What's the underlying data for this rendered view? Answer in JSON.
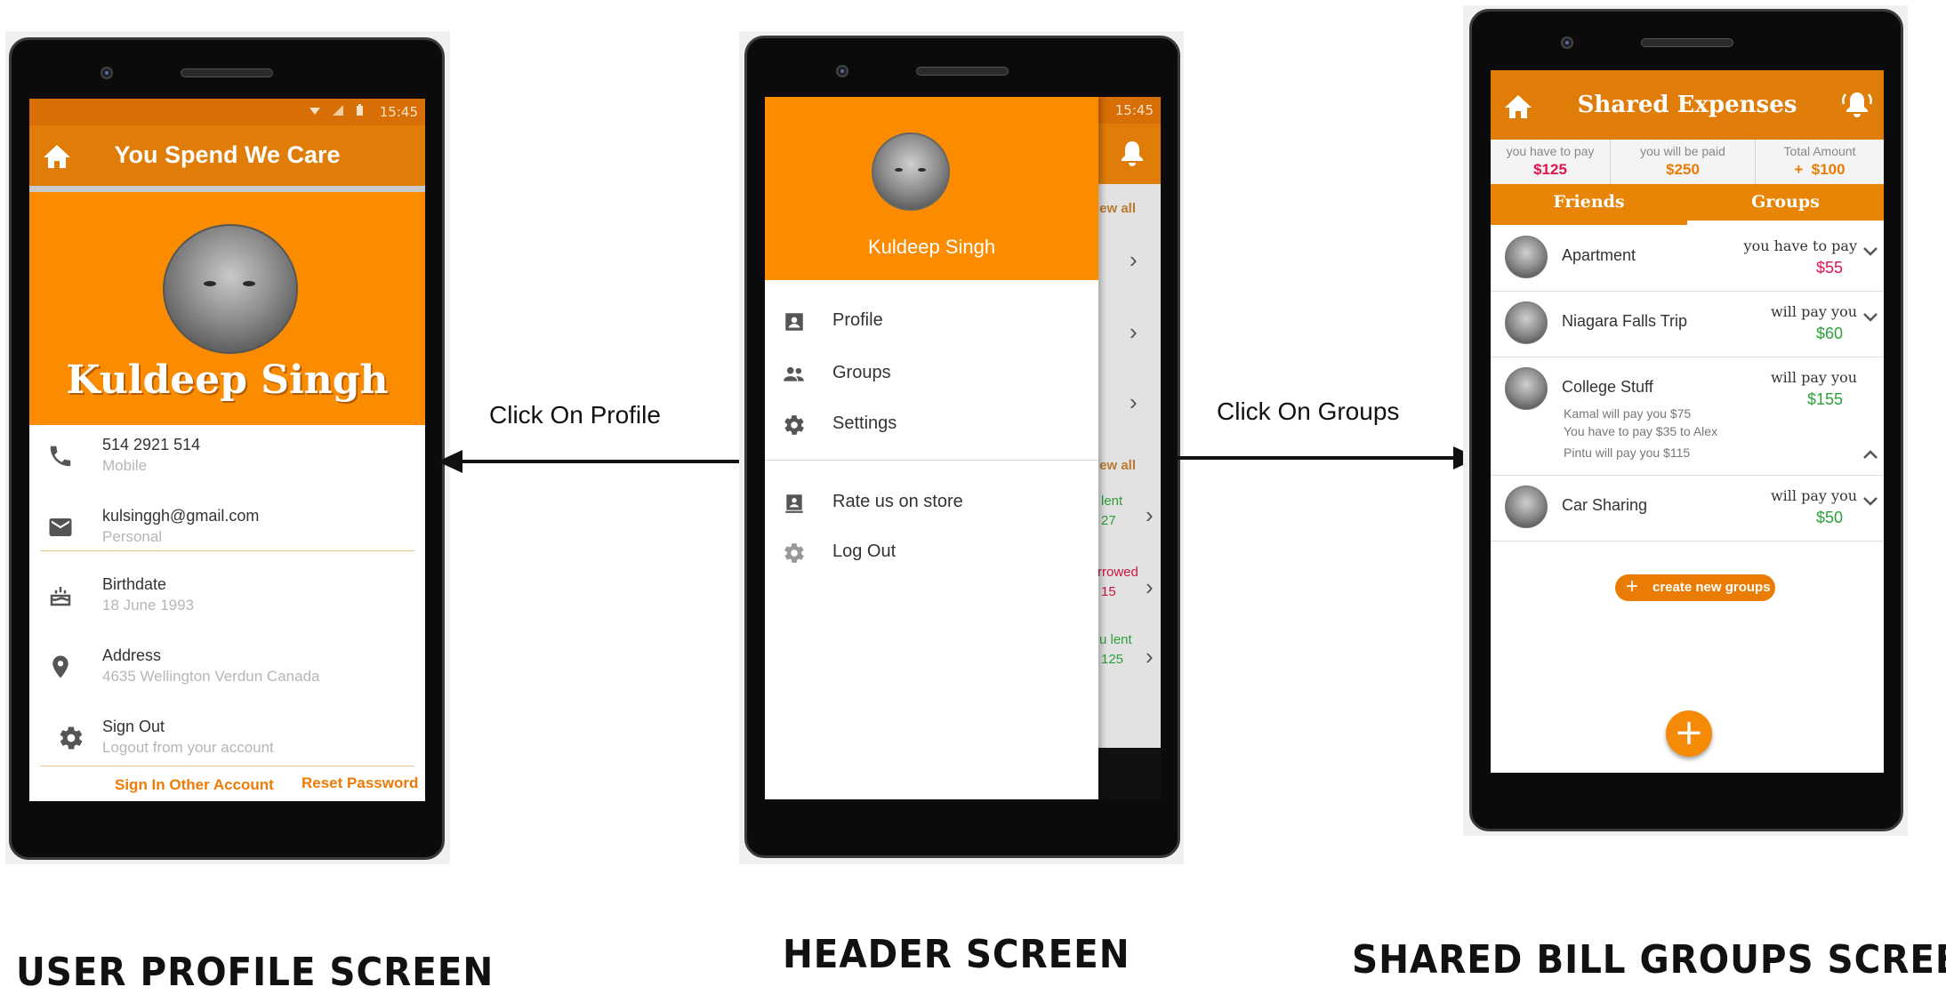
{
  "captions": {
    "profile": "USER PROFILE SCREEN",
    "header": "HEADER SCREEN",
    "groups": "SHARED BILL GROUPS SCREEN"
  },
  "arrows": {
    "profile_label": "Click On Profile",
    "groups_label": "Click On Groups"
  },
  "profile_screen": {
    "status_time": "15:45",
    "app_title": "You Spend We Care",
    "user_name": "Kuldeep Singh",
    "rows": [
      {
        "icon": "phone-icon",
        "main": "514 2921 514",
        "sub": "Mobile"
      },
      {
        "icon": "email-icon",
        "main": "kulsinggh@gmail.com",
        "sub": "Personal"
      },
      {
        "icon": "cake-icon",
        "main": "Birthdate",
        "sub": "18 June 1993"
      },
      {
        "icon": "location-pin-icon",
        "main": "Address",
        "sub": "4635 Wellington Verdun Canada"
      },
      {
        "icon": "gear-icon",
        "main": "Sign Out",
        "sub": "Logout from your account"
      }
    ],
    "links": {
      "sign_in_other": "Sign In Other Account",
      "reset_password": "Reset Password"
    }
  },
  "header_screen": {
    "status_time": "15:45",
    "drawer_name": "Kuldeep Singh",
    "menu": [
      {
        "icon": "profile-icon",
        "label": "Profile"
      },
      {
        "icon": "groups-icon",
        "label": "Groups"
      },
      {
        "icon": "gear-icon",
        "label": "Settings"
      }
    ],
    "menu_secondary": [
      {
        "icon": "store-icon",
        "label": "Rate us on store"
      },
      {
        "icon": "gear-icon",
        "label": "Log Out"
      }
    ],
    "background_fragments": {
      "view_all_1": "iew all",
      "view_all_2": "iew all",
      "lent_1": "lent",
      "lent_1_amt": "27",
      "borrowed": "rrowed",
      "borrowed_amt": "15",
      "lent_2": "u lent",
      "lent_2_amt": "125"
    }
  },
  "groups_screen": {
    "title": "Shared Expenses",
    "summary": [
      {
        "label": "you have to pay",
        "value": "$125"
      },
      {
        "label": "you will be paid",
        "value": "$250"
      },
      {
        "label": "Total Amount",
        "value": "+  $100"
      }
    ],
    "tabs": [
      "Friends",
      "Groups"
    ],
    "active_tab": "Groups",
    "groups": [
      {
        "name": "Apartment",
        "status": "you have to pay",
        "amount": "$55",
        "amount_color": "#e0144c"
      },
      {
        "name": "Niagara Falls Trip",
        "status": "will pay you",
        "amount": "$60",
        "amount_color": "#2ea03b"
      },
      {
        "name": "College Stuff",
        "status": "will pay you",
        "amount": "$155",
        "amount_color": "#2ea03b",
        "details": [
          "Kamal will pay you $75",
          "You have to pay $35 to Alex",
          "Pintu will pay you $115"
        ]
      },
      {
        "name": "Car Sharing",
        "status": "will pay you",
        "amount": "$50",
        "amount_color": "#2ea03b"
      }
    ],
    "create_button": "create new groups",
    "fab": "+"
  },
  "colors": {
    "primary": "#fb8c00",
    "primary_dark": "#e07d08",
    "red_amount": "#e0144c",
    "green_amount": "#2ea03b"
  }
}
